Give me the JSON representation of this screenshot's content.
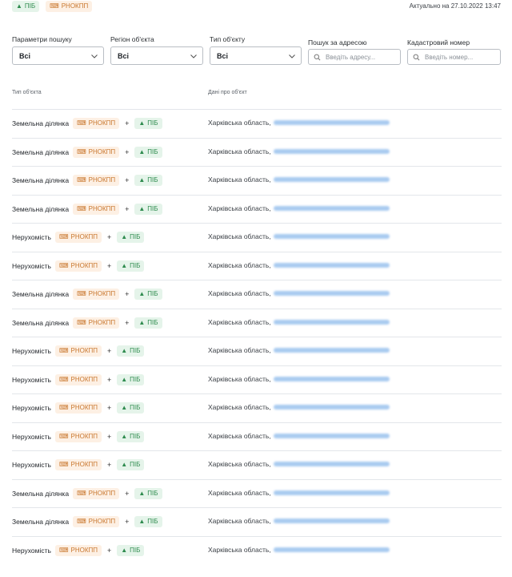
{
  "header": {
    "badges": [
      {
        "label": "ПІБ",
        "tone": "green",
        "icon": "person-icon"
      },
      {
        "label": "РНОКПП",
        "tone": "orange",
        "icon": "id-icon"
      }
    ],
    "updated": "Актуально на 27.10.2022 13:47"
  },
  "filters": {
    "search_params": {
      "label": "Параметри пошуку",
      "value": "Всі"
    },
    "region": {
      "label": "Регіон об'єкта",
      "value": "Всі"
    },
    "object_type": {
      "label": "Тип об'єкту",
      "value": "Всі"
    },
    "address": {
      "label": "Пошук за адресою",
      "placeholder": "Введіть адресу..."
    },
    "cadastral": {
      "label": "Кадастровий номер",
      "placeholder": "Введіть номер..."
    }
  },
  "table": {
    "columns": {
      "type": "Тип об'єкта",
      "data": "Дані про об'єкт"
    },
    "tag_rnokpp": "РНОКПП",
    "tag_pib": "ПІБ",
    "plus": "+",
    "rows": [
      {
        "type": "Земельна ділянка",
        "region": "Харківська область,"
      },
      {
        "type": "Земельна ділянка",
        "region": "Харківська область,"
      },
      {
        "type": "Земельна ділянка",
        "region": "Харківська область,"
      },
      {
        "type": "Земельна ділянка",
        "region": "Харківська область,"
      },
      {
        "type": "Нерухомість",
        "region": "Харківська область,"
      },
      {
        "type": "Нерухомість",
        "region": "Харківська область,"
      },
      {
        "type": "Земельна ділянка",
        "region": "Харківська область,"
      },
      {
        "type": "Земельна ділянка",
        "region": "Харківська область,"
      },
      {
        "type": "Нерухомість",
        "region": "Харківська область,"
      },
      {
        "type": "Нерухомість",
        "region": "Харківська область,"
      },
      {
        "type": "Нерухомість",
        "region": "Харківська область,"
      },
      {
        "type": "Нерухомість",
        "region": "Харківська область,"
      },
      {
        "type": "Нерухомість",
        "region": "Харківська область,"
      },
      {
        "type": "Земельна ділянка",
        "region": "Харківська область,"
      },
      {
        "type": "Земельна ділянка",
        "region": "Харківська область,"
      },
      {
        "type": "Нерухомість",
        "region": "Харківська область,"
      }
    ]
  }
}
